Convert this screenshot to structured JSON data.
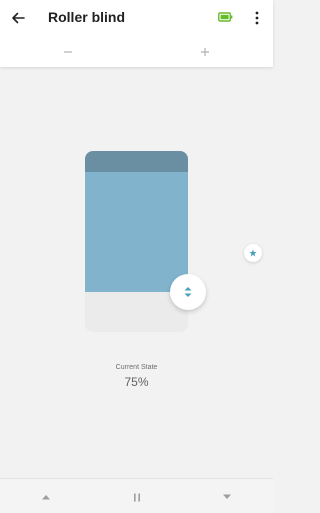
{
  "header": {
    "title": "Roller blind",
    "back_icon": "arrow-left-icon",
    "battery_icon": "battery-full-icon",
    "menu_icon": "more-vertical-icon"
  },
  "controls": {
    "decrease_icon": "minus-icon",
    "increase_icon": "plus-icon"
  },
  "blind": {
    "position_percent": 75,
    "handle_icon": "up-down-chevrons-icon",
    "favorite_icon": "star-icon"
  },
  "state": {
    "label": "Current State",
    "value": "75%"
  },
  "bottom_controls": {
    "open_icon": "triangle-up-icon",
    "stop_icon": "pause-icon",
    "close_icon": "triangle-down-icon"
  },
  "colors": {
    "blind_fill": "#82b3cd",
    "blind_head": "#6a8fa2",
    "battery": "#66bb2a",
    "accent": "#4a9fbd"
  }
}
